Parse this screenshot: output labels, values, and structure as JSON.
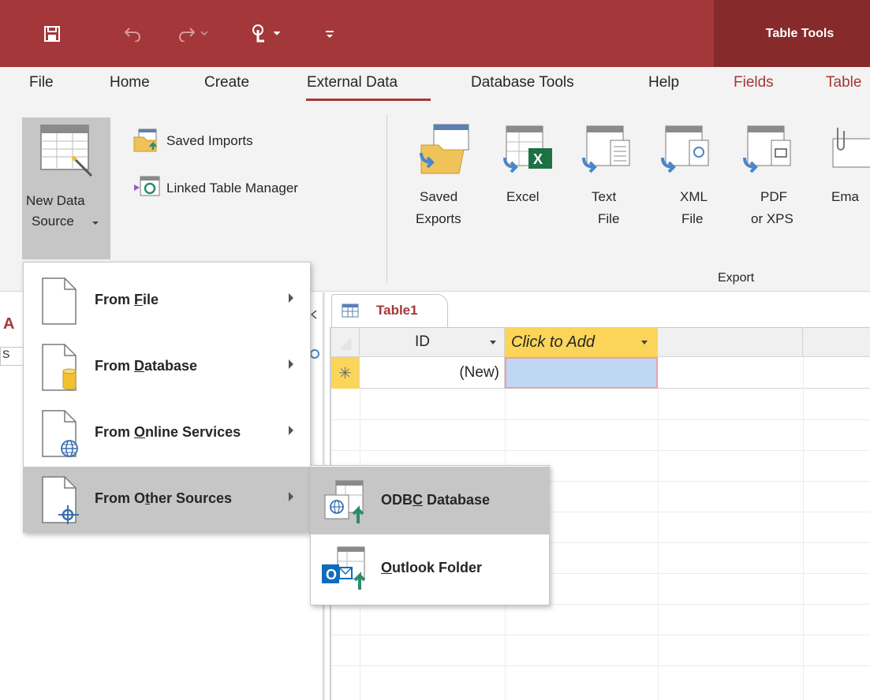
{
  "titlebar": {
    "icons": [
      "save-icon",
      "undo-icon",
      "redo-icon",
      "touch-mode-icon",
      "customize-qat-icon"
    ],
    "context_title": "Table Tools",
    "accent_color": "#a4373a"
  },
  "ribbon_tabs": {
    "file": "File",
    "home": "Home",
    "create": "Create",
    "external_data": "External Data",
    "database_tools": "Database Tools",
    "help": "Help",
    "fields": "Fields",
    "table": "Table"
  },
  "ribbon": {
    "new_data_source_line1": "New Data",
    "new_data_source_line2": "Source",
    "saved_imports": "Saved Imports",
    "linked_table_manager": "Linked Table Manager",
    "saved_exports_line1": "Saved",
    "saved_exports_line2": "Exports",
    "excel": "Excel",
    "text_file_line1": "Text",
    "text_file_line2": "File",
    "xml_file_line1": "XML",
    "xml_file_line2": "File",
    "pdf_line1": "PDF",
    "pdf_line2": "or XPS",
    "email": "Ema",
    "export_group": "Export"
  },
  "menu": {
    "from_file_pre": "From ",
    "from_file_key": "F",
    "from_file_post": "ile",
    "from_database_pre": "From ",
    "from_database_key": "D",
    "from_database_post": "atabase",
    "from_online_pre": "From ",
    "from_online_key": "O",
    "from_online_post": "nline Services",
    "from_other_pre": "From O",
    "from_other_key": "t",
    "from_other_post": "her Sources"
  },
  "submenu": {
    "odbc_pre": "ODB",
    "odbc_key": "C",
    "odbc_post": " Database",
    "outlook_key": "O",
    "outlook_post": "utlook Folder"
  },
  "nav": {
    "partial_title": "A",
    "partial_search": "S"
  },
  "datasheet": {
    "tab_label": "Table1",
    "col_id": "ID",
    "col_add": "Click to Add",
    "new_row_marker": "✳",
    "new_row_value": "(New)"
  }
}
